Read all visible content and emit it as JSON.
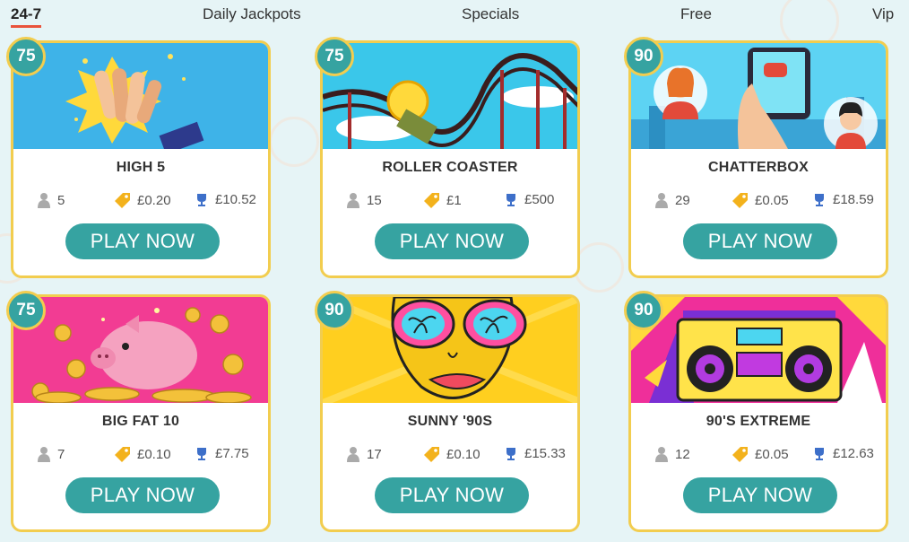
{
  "tabs": [
    {
      "label": "24-7"
    },
    {
      "label": "Daily Jackpots"
    },
    {
      "label": "Specials"
    },
    {
      "label": "Free"
    },
    {
      "label": "Vip"
    }
  ],
  "cards": [
    {
      "title": "HIGH 5",
      "badge": "75",
      "players": "5",
      "price": "£0.20",
      "jackpot": "£10.52",
      "button": "PLAY NOW",
      "art": "high-five"
    },
    {
      "title": "ROLLER COASTER",
      "badge": "75",
      "players": "15",
      "price": "£1",
      "jackpot": "£500",
      "button": "PLAY NOW",
      "art": "roller-coaster"
    },
    {
      "title": "CHATTERBOX",
      "badge": "90",
      "players": "29",
      "price": "£0.05",
      "jackpot": "£18.59",
      "button": "PLAY NOW",
      "art": "chatterbox"
    },
    {
      "title": "BIG FAT 10",
      "badge": "75",
      "players": "7",
      "price": "£0.10",
      "jackpot": "£7.75",
      "button": "PLAY NOW",
      "art": "piggy-bank"
    },
    {
      "title": "SUNNY '90S",
      "badge": "90",
      "players": "17",
      "price": "£0.10",
      "jackpot": "£15.33",
      "button": "PLAY NOW",
      "art": "sunglasses"
    },
    {
      "title": "90'S EXTREME",
      "badge": "90",
      "players": "12",
      "price": "£0.05",
      "jackpot": "£12.63",
      "button": "PLAY NOW",
      "art": "boombox"
    }
  ],
  "colors": {
    "accent": "#36a3a1",
    "border": "#f2cd4f",
    "tab_underline": "#e9533b"
  }
}
